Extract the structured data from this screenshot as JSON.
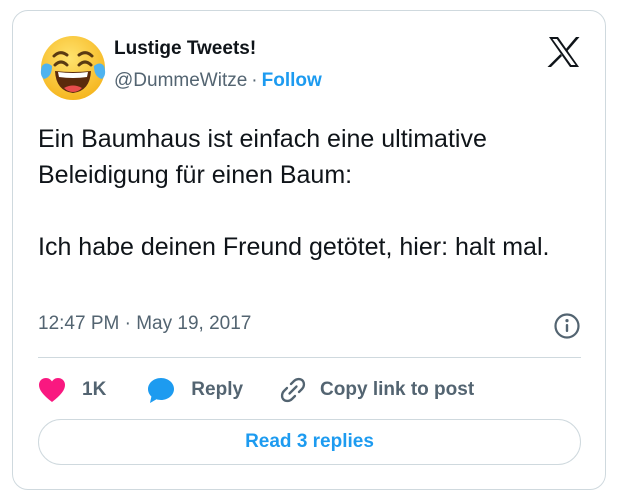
{
  "author": {
    "name": "Lustige Tweets!",
    "handle": "@DummeWitze",
    "separator": "·",
    "follow_label": "Follow",
    "avatar_icon": "laughing-tears-emoji"
  },
  "platform": {
    "logo_icon": "x-logo"
  },
  "tweet": {
    "lines": [
      "Ein Baumhaus ist einfach eine ultimative Beleidigung für einen Baum:",
      "Ich habe deinen Freund getötet, hier: halt mal."
    ],
    "timestamp": "12:47 PM · May 19, 2017",
    "info_icon": "info-icon"
  },
  "actions": {
    "like_count": "1K",
    "reply_label": "Reply",
    "copy_link_label": "Copy link to post"
  },
  "footer": {
    "read_replies_label": "Read 3 replies"
  },
  "colors": {
    "accent": "#1d9bf0",
    "like": "#f91880",
    "text": "#0f1419",
    "muted": "#536471",
    "border": "#cfd9de"
  }
}
